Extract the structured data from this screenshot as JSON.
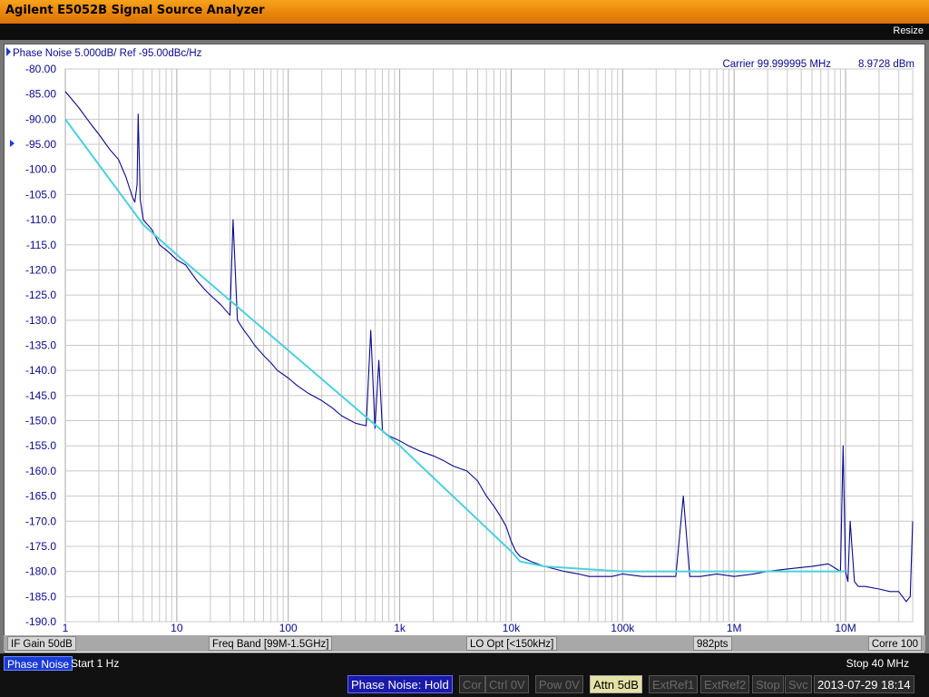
{
  "window": {
    "title": "Agilent E5052B Signal Source Analyzer",
    "resize_label": "Resize"
  },
  "trace": {
    "header": "Phase Noise 5.000dB/ Ref -95.00dBc/Hz",
    "carrier_label": "Carrier 99.999995 MHz",
    "carrier_power": "8.9728 dBm",
    "ref_marker_label": "-95.00"
  },
  "colors": {
    "trace": "#0a0a8c",
    "smooth": "#4cd0dc",
    "grid": "#c8c8c8",
    "accent_blue": "#1a3bd6"
  },
  "infobar": {
    "if_gain": "IF Gain 50dB",
    "freq_band": "Freq Band [99M-1.5GHz]",
    "lo_opt": "LO Opt [<150kHz]",
    "points": "982pts",
    "corre": "Corre 100"
  },
  "sweep": {
    "meas_tab": "Phase Noise",
    "start": "Start 1 Hz",
    "stop": "Stop 40 MHz"
  },
  "status": {
    "meas_state": "Phase Noise: Hold",
    "cor": "Cor",
    "ctrl": "Ctrl  0V",
    "pow": "Pow  0V",
    "attn": "Attn 5dB",
    "extref1": "ExtRef1",
    "extref2": "ExtRef2",
    "stop": "Stop",
    "svc": "Svc",
    "datetime": "2013-07-29 18:14"
  },
  "chart_data": {
    "type": "line",
    "title": "Phase Noise 5.000dB/ Ref -95.00dBc/Hz",
    "x_scale": "log",
    "x_range_hz": [
      1,
      40000000
    ],
    "x_tick_labels": [
      "1",
      "10",
      "100",
      "1k",
      "10k",
      "100k",
      "1M",
      "10M"
    ],
    "x_tick_values": [
      1,
      10,
      100,
      1000,
      10000,
      100000,
      1000000,
      10000000
    ],
    "y_range": [
      -190,
      -80
    ],
    "y_ticks": [
      -80,
      -85,
      -90,
      -95,
      -100,
      -105,
      -110,
      -115,
      -120,
      -125,
      -130,
      -135,
      -140,
      -145,
      -150,
      -155,
      -160,
      -165,
      -170,
      -175,
      -180,
      -185,
      -190
    ],
    "y_tick_labels": [
      "-80.00",
      "-85.00",
      "-90.00",
      "-95.00",
      "-100.0",
      "-105.0",
      "-110.0",
      "-115.0",
      "-120.0",
      "-125.0",
      "-130.0",
      "-135.0",
      "-140.0",
      "-145.0",
      "-150.0",
      "-155.0",
      "-160.0",
      "-165.0",
      "-170.0",
      "-175.0",
      "-180.0",
      "-185.0",
      "-190.0"
    ],
    "reference_level": -95,
    "grid": true,
    "series": [
      {
        "style": "measured",
        "x": [
          1,
          1.3,
          1.7,
          2,
          2.5,
          3,
          3.5,
          4,
          4.2,
          4.4,
          4.5,
          4.7,
          5,
          6,
          7,
          8,
          9,
          10,
          12,
          15,
          18,
          20,
          25,
          30,
          32,
          35,
          40,
          45,
          50,
          60,
          70,
          80,
          100,
          120,
          150,
          200,
          250,
          300,
          400,
          500,
          550,
          600,
          650,
          700,
          800,
          1000,
          1200,
          1500,
          2000,
          2500,
          3000,
          4000,
          5000,
          6000,
          7000,
          8000,
          9000,
          10000,
          11000,
          12000,
          15000,
          20000,
          30000,
          40000,
          50000,
          60000,
          80000,
          100000,
          150000,
          200000,
          300000,
          350000,
          400000,
          500000,
          700000,
          1000000,
          1500000,
          2000000,
          3000000,
          5000000,
          7000000,
          9000000,
          9500000,
          10000000,
          10500000,
          11000000,
          12000000,
          13000000,
          15000000,
          20000000,
          25000000,
          30000000,
          35000000,
          38000000,
          40000000
        ],
        "y": [
          -84.5,
          -87.5,
          -91,
          -93,
          -96,
          -98,
          -101.5,
          -105.5,
          -106.5,
          -103,
          -89,
          -106,
          -110,
          -112,
          -115,
          -116,
          -117,
          -118,
          -119,
          -122,
          -124,
          -125,
          -127,
          -129,
          -110,
          -130,
          -132,
          -133.5,
          -135,
          -137,
          -138.5,
          -140,
          -141.5,
          -143,
          -144.5,
          -146,
          -147.5,
          -149,
          -150.5,
          -151,
          -132,
          -151.5,
          -138,
          -152,
          -153,
          -154,
          -155,
          -156,
          -157,
          -158,
          -159,
          -160,
          -162,
          -165,
          -167,
          -169,
          -171,
          -174,
          -176,
          -177,
          -178,
          -179,
          -180,
          -180.5,
          -181,
          -181,
          -181,
          -180.5,
          -181,
          -181,
          -181,
          -165,
          -181,
          -181,
          -180.5,
          -181,
          -180.5,
          -180,
          -179.5,
          -179,
          -178.5,
          -180,
          -155,
          -180,
          -182,
          -170,
          -182,
          -183,
          -183,
          -183.5,
          -184,
          -184,
          -186,
          -185,
          -170
        ]
      },
      {
        "style": "smoothed",
        "x": [
          1,
          5,
          10,
          100,
          1000,
          10000,
          12000,
          20000,
          100000,
          1000000,
          10000000
        ],
        "y": [
          -90,
          -111,
          -117,
          -136,
          -155,
          -176,
          -178,
          -179,
          -180,
          -180,
          -180
        ]
      }
    ]
  }
}
